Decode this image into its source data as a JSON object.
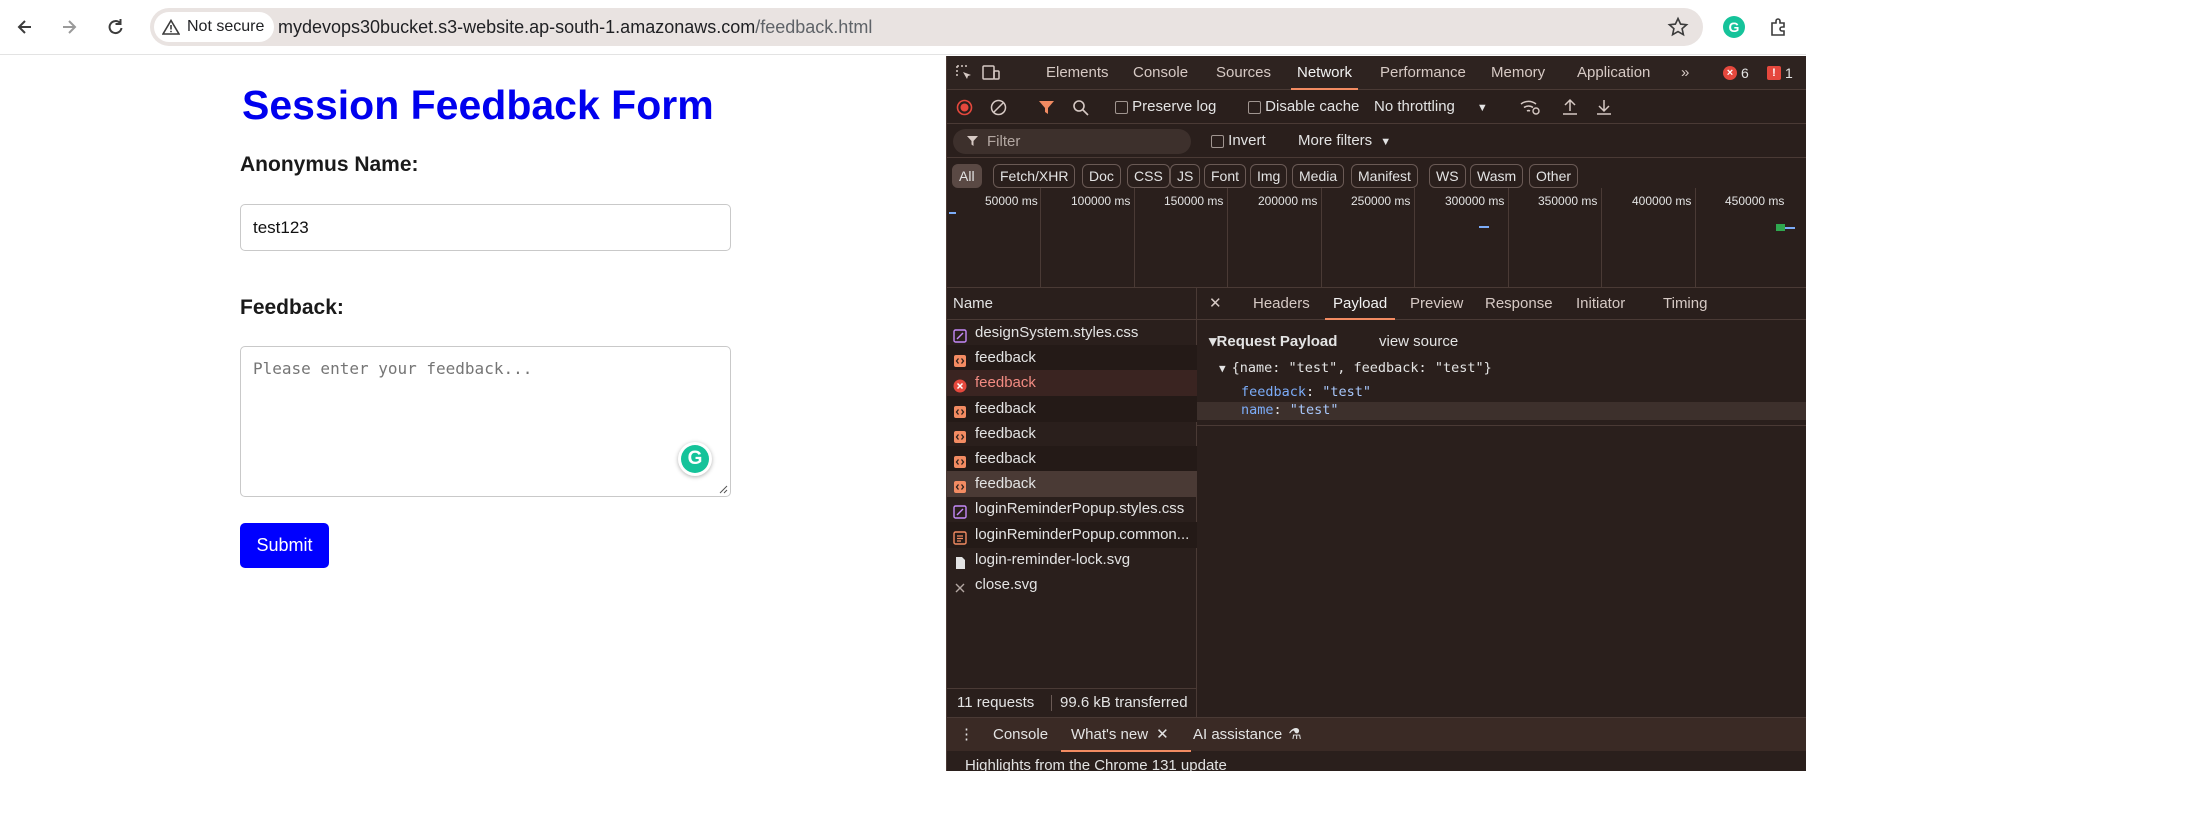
{
  "browser": {
    "security_label": "Not secure",
    "url_host": "mydevops30bucket.s3-website.ap-south-1.amazonaws.com",
    "url_path": "/feedback.html"
  },
  "form": {
    "title": "Session Feedback Form",
    "name_label": "Anonymus Name:",
    "name_value": "test123",
    "feedback_label": "Feedback:",
    "feedback_placeholder": "Please enter your feedback...",
    "submit_label": "Submit"
  },
  "devtools": {
    "tabs": [
      "Elements",
      "Console",
      "Sources",
      "Network",
      "Performance",
      "Memory",
      "Application"
    ],
    "active_tab": "Network",
    "error_count": "6",
    "issue_count": "1",
    "preserve_log": "Preserve log",
    "disable_cache": "Disable cache",
    "throttling": "No throttling",
    "filter_placeholder": "Filter",
    "invert": "Invert",
    "more_filters": "More filters",
    "type_filters": [
      "All",
      "Fetch/XHR",
      "Doc",
      "CSS",
      "JS",
      "Font",
      "Img",
      "Media",
      "Manifest",
      "WS",
      "Wasm",
      "Other"
    ],
    "timeline_ticks": [
      "50000 ms",
      "100000 ms",
      "150000 ms",
      "200000 ms",
      "250000 ms",
      "300000 ms",
      "350000 ms",
      "400000 ms",
      "450000 ms"
    ],
    "name_column": "Name",
    "requests": [
      {
        "name": "designSystem.styles.css",
        "icon": "css-file-icon"
      },
      {
        "name": "feedback",
        "icon": "fetch-icon"
      },
      {
        "name": "feedback",
        "icon": "error-icon"
      },
      {
        "name": "feedback",
        "icon": "fetch-icon"
      },
      {
        "name": "feedback",
        "icon": "fetch-icon"
      },
      {
        "name": "feedback",
        "icon": "fetch-icon"
      },
      {
        "name": "feedback",
        "icon": "fetch-icon"
      },
      {
        "name": "loginReminderPopup.styles.css",
        "icon": "css-file-icon"
      },
      {
        "name": "loginReminderPopup.common...",
        "icon": "script-file-icon"
      },
      {
        "name": "login-reminder-lock.svg",
        "icon": "document-file-icon"
      },
      {
        "name": "close.svg",
        "icon": "close-icon"
      }
    ],
    "detail_tabs": [
      "Headers",
      "Payload",
      "Preview",
      "Response",
      "Initiator",
      "Timing"
    ],
    "active_detail_tab": "Payload",
    "payload_title": "Request Payload",
    "view_source": "view source",
    "payload_summary": "{name: \"test\", feedback: \"test\"}",
    "payload_fields": [
      {
        "key": "feedback",
        "value": "\"test\""
      },
      {
        "key": "name",
        "value": "\"test\""
      }
    ],
    "requests_count": "11 requests",
    "transferred": "99.6 kB transferred",
    "drawer_tabs": [
      "Console",
      "What's new",
      "AI assistance"
    ],
    "drawer_text": "Highlights from the Chrome 131 update"
  },
  "colors": {
    "title_blue": "#0000ee",
    "submit_blue": "#0000ff",
    "devtools_accent": "#f28b62",
    "error_red": "#e5483d"
  }
}
